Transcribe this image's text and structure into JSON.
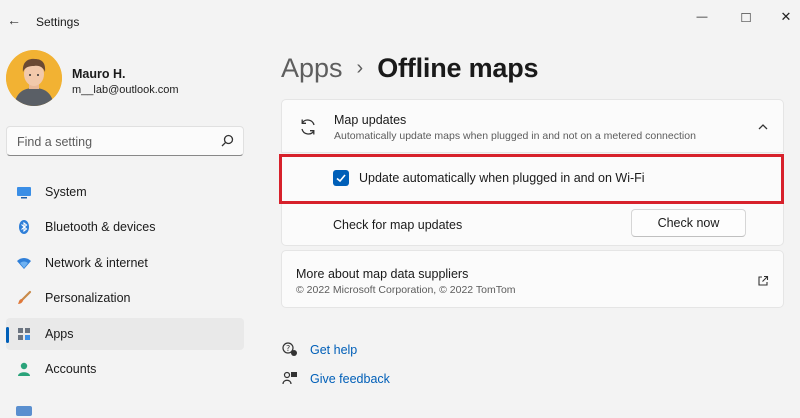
{
  "window": {
    "title": "Settings",
    "back_glyph": "←",
    "minimize_glyph": "—",
    "maximize_glyph": "□",
    "close_glyph": "✕"
  },
  "profile": {
    "name": "Mauro H.",
    "email": "m__lab@outlook.com"
  },
  "search": {
    "placeholder": "Find a setting"
  },
  "sidebar": {
    "items": [
      {
        "label": "System",
        "icon": "monitor-icon"
      },
      {
        "label": "Bluetooth & devices",
        "icon": "bluetooth-icon"
      },
      {
        "label": "Network & internet",
        "icon": "wifi-icon"
      },
      {
        "label": "Personalization",
        "icon": "paintbrush-icon"
      },
      {
        "label": "Apps",
        "icon": "apps-icon",
        "active": true
      },
      {
        "label": "Accounts",
        "icon": "person-icon"
      }
    ]
  },
  "breadcrumb": {
    "parent": "Apps",
    "separator": "›",
    "current": "Offline maps"
  },
  "map_updates": {
    "title": "Map updates",
    "subtitle": "Automatically update maps when plugged in and not on a metered connection",
    "expanded": true,
    "auto_update_label": "Update automatically when plugged in and on Wi-Fi",
    "auto_update_checked": true,
    "check_label": "Check for map updates",
    "check_button": "Check now"
  },
  "suppliers": {
    "title": "More about map data suppliers",
    "copyright": "© 2022 Microsoft Corporation, © 2022 TomTom"
  },
  "links": {
    "help": "Get help",
    "feedback": "Give feedback"
  },
  "colors": {
    "accent": "#005fb8",
    "highlight_border": "#d7212b",
    "background": "#f3f3f3",
    "card": "#fbfbfb"
  }
}
